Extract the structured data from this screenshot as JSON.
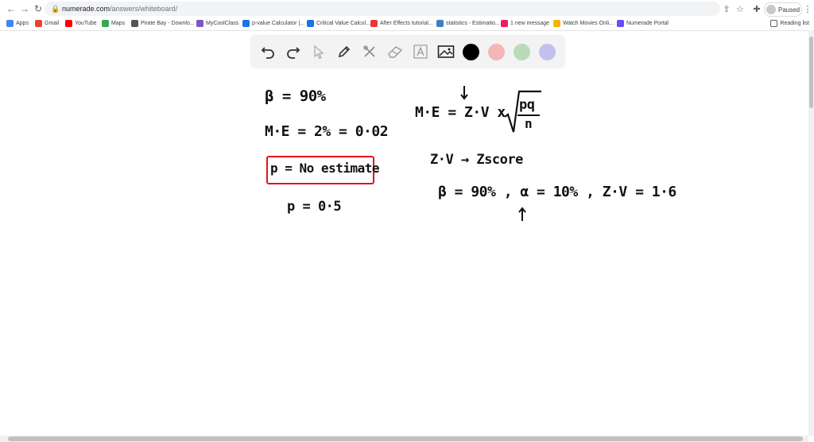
{
  "browser": {
    "url_host": "numerade.com",
    "url_path": "/answers/whiteboard/",
    "profile_label": "Paused",
    "reading_list": "Reading list"
  },
  "bookmarks": [
    {
      "label": "Apps",
      "color": "#4285f4"
    },
    {
      "label": "Gmail",
      "color": "#ea4335"
    },
    {
      "label": "YouTube",
      "color": "#ff0000"
    },
    {
      "label": "Maps",
      "color": "#34a853"
    },
    {
      "label": "Pirate Bay - Downlo...",
      "color": "#555555"
    },
    {
      "label": "MyCoolClass",
      "color": "#7e57c2"
    },
    {
      "label": "p-value Calculator |...",
      "color": "#1a73e8"
    },
    {
      "label": "Critical Value Calcul...",
      "color": "#1a73e8"
    },
    {
      "label": "After Effects tutorial...",
      "color": "#e53935"
    },
    {
      "label": "statistics - Estimatio...",
      "color": "#3f7fbf"
    },
    {
      "label": "1 new message",
      "color": "#e91e63"
    },
    {
      "label": "Watch Movies Onli...",
      "color": "#f4b400"
    },
    {
      "label": "Numerade Portal",
      "color": "#6d4aff"
    }
  ],
  "toolbar": {
    "tools": [
      "undo-icon",
      "redo-icon",
      "pointer-icon",
      "pen-icon",
      "tools-icon",
      "eraser-icon",
      "text-icon",
      "image-icon"
    ],
    "colors": [
      "#000000",
      "#f4b6b6",
      "#b9dbb9",
      "#c3c0ee"
    ]
  },
  "whiteboard": {
    "left_lines": [
      "β = 90%",
      "M·E = 2% = 0·02",
      "p = No estimate",
      "p = 0·5"
    ],
    "right_formula_lhs": "M·E = Z·V x",
    "right_formula_num": "pq",
    "right_formula_den": "n",
    "right_lines": [
      "Z·V → Zscore",
      "β = 90% , α = 10% , Z·V = 1·6"
    ],
    "box_color": "#e0151b"
  }
}
